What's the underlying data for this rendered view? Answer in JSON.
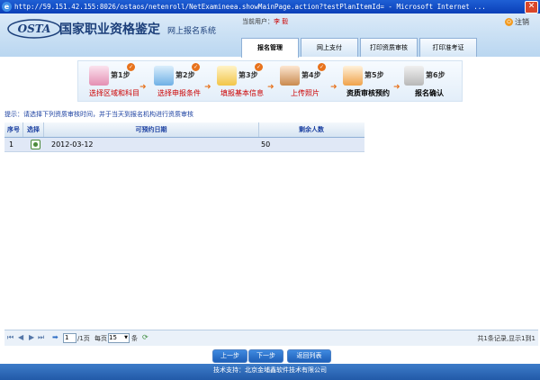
{
  "window": {
    "title": "http://59.151.42.155:8026/ostaos/netenroll/NetExamineea.showMainPage.action?testPlanItemId= - Microsoft Internet ..."
  },
  "header": {
    "logo_text": "OSTA",
    "org_name": "国家职业资格鉴定",
    "system_name": "网上报名系统",
    "current_user_label": "当前用户：",
    "current_user_name": "李 毅",
    "logout_label": "注销",
    "tabs": [
      {
        "label": "报名管理",
        "active": true
      },
      {
        "label": "网上支付",
        "active": false
      },
      {
        "label": "打印资质审核",
        "active": false
      },
      {
        "label": "打印准考证",
        "active": false
      }
    ]
  },
  "steps": [
    {
      "num": "第1步",
      "name": "选择区域和科目",
      "done": true
    },
    {
      "num": "第2步",
      "name": "选择申报条件",
      "done": true
    },
    {
      "num": "第3步",
      "name": "填报基本信息",
      "done": true
    },
    {
      "num": "第4步",
      "name": "上传照片",
      "done": true
    },
    {
      "num": "第5步",
      "name": "资质审核预约",
      "done": false
    },
    {
      "num": "第6步",
      "name": "报名确认",
      "done": false
    }
  ],
  "hint": "提示：请选择下列资质审核时间，并于当天到报名机构进行资质审核",
  "table": {
    "columns": [
      "序号",
      "选择",
      "可预约日期",
      "剩余人数"
    ],
    "rows": [
      {
        "index": "1",
        "date": "2012-03-12",
        "remaining": "50"
      }
    ]
  },
  "pager": {
    "page_input": "1",
    "page_total": "/1页",
    "per_page_label": "每页",
    "per_page_value": "15",
    "per_page_unit": "条",
    "status": "共1条记录,显示1到1"
  },
  "buttons": {
    "prev": "上一步",
    "next": "下一步",
    "back": "返回列表"
  },
  "footer": "技术支持：北京金埔鑫软件技术有限公司",
  "colors": {
    "accent": "#1a3fa0",
    "brand": "#225aa8",
    "step_check": "#e8731d",
    "step_name": "#cc0000"
  }
}
